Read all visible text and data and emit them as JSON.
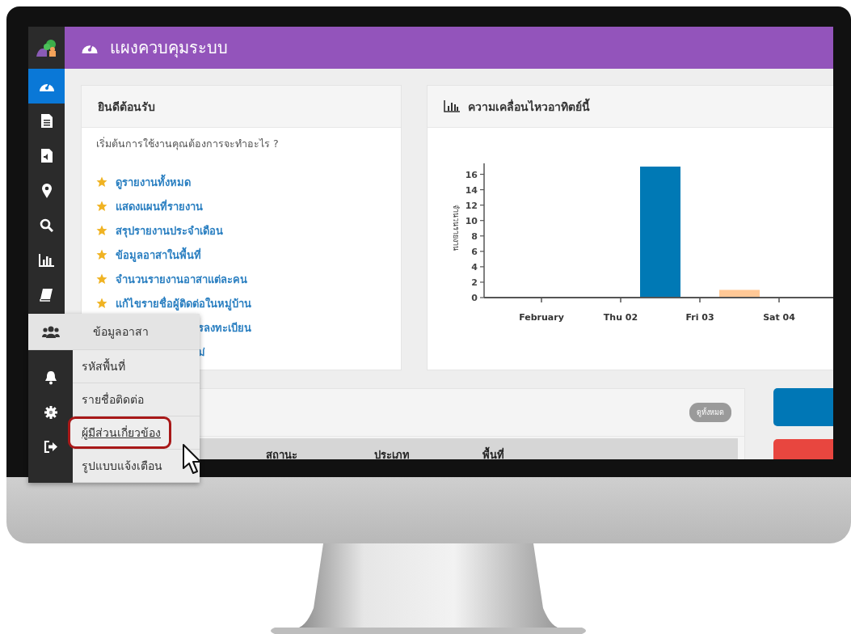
{
  "header": {
    "title": "แผงควบคุมระบบ"
  },
  "sidebar": {
    "items": [
      {
        "kind": "dashboard",
        "selected": true
      },
      {
        "kind": "file",
        "selected": false
      },
      {
        "kind": "audio",
        "selected": false
      },
      {
        "kind": "pin",
        "selected": false
      },
      {
        "kind": "search",
        "selected": false
      },
      {
        "kind": "chart",
        "selected": false
      },
      {
        "kind": "book",
        "selected": false
      }
    ]
  },
  "welcome": {
    "title": "ยินดีต้อนรับ",
    "intro": "เริ่มต้นการใช้งานคุณต้องการจะทำอะไร ?",
    "links": [
      {
        "text": "ดูรายงานทั้งหมด",
        "kind": "full"
      },
      {
        "text": "แสดงแผนที่รายงาน",
        "kind": "full"
      },
      {
        "text": "สรุปรายงานประจำเดือน",
        "kind": "full"
      },
      {
        "text": "ข้อมูลอาสาในพื้นที่",
        "kind": "full"
      },
      {
        "text": "จำนวนรายงานอาสาแต่ละคน",
        "kind": "full"
      },
      {
        "text": "แก้ไขรายชื่อผู้ติดต่อในหมู่บ้าน",
        "kind": "full"
      },
      {
        "text": "รลงทะเบียน",
        "kind": "partial"
      },
      {
        "text": "ม่",
        "kind": "partial"
      }
    ]
  },
  "activity": {
    "title": "ความเคลื่อนไหวอาทิตย์นี้",
    "chart_data": {
      "type": "bar",
      "ylabel": "จำนวนรายงาน",
      "categories": [
        "February",
        null,
        "Thu 02",
        null,
        "Fri 03",
        null,
        "Sat 04",
        null
      ],
      "ylim": [
        0,
        17
      ],
      "yticks": [
        0,
        2,
        4,
        6,
        8,
        10,
        12,
        14,
        16
      ],
      "series": [
        {
          "color": "#0079b5",
          "values": [
            null,
            null,
            null,
            17,
            null,
            null,
            null,
            null
          ]
        },
        {
          "color": "#ffc896",
          "values": [
            null,
            null,
            null,
            null,
            null,
            1,
            null,
            null
          ]
        }
      ]
    }
  },
  "reports": {
    "view_all": "ดูทั้งหมด",
    "columns": [
      "สถานะ",
      "ประเภท",
      "พื้นที่"
    ]
  },
  "side_buttons": [
    {
      "color": "#0077b6"
    },
    {
      "color": "#e8463f"
    }
  ],
  "menu": {
    "items": [
      {
        "text": "ข้อมูลอาสา",
        "kind": "header",
        "highlighted": false
      },
      {
        "text": "รหัสพื้นที่",
        "kind": "link",
        "highlighted": false
      },
      {
        "text": "รายชื่อติดต่อ",
        "kind": "link",
        "highlighted": false
      },
      {
        "text": "ผู้มีส่วนเกี่ยวข้อง",
        "kind": "link",
        "highlighted": true
      },
      {
        "text": "รูปแบบแจ้งเตือน",
        "kind": "link",
        "highlighted": false
      }
    ]
  }
}
